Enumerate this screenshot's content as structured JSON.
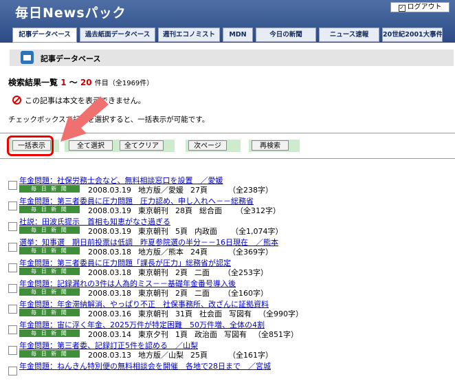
{
  "header": {
    "logo": "毎日Newsパック",
    "logout_label": "ログアウト",
    "tabs": [
      {
        "label": "記事データベース",
        "active": true
      },
      {
        "label": "過去紙面データベース",
        "active": false
      },
      {
        "label": "週刊エコノミスト",
        "active": false
      },
      {
        "label": "MDN",
        "active": false
      },
      {
        "label": "今日の新聞",
        "active": false
      },
      {
        "label": "ニュース速報",
        "active": false
      },
      {
        "label": "20世紀2001大事件",
        "active": false
      }
    ]
  },
  "page_title": "記事データベース",
  "results": {
    "label": "検索結果一覧",
    "from": "1",
    "sep": "～",
    "to": "20",
    "unit": "件目",
    "total": "（全1969件）"
  },
  "notice": "この記事は本文を表示できません。",
  "hint": "チェックボックスで記事を選択すると、一括表示が可能です。",
  "buttons": {
    "bulk_show": "一括表示",
    "select_all": "全て選択",
    "clear_all": "全てクリア",
    "next_page": "次ページ",
    "research": "再検索"
  },
  "source_badge": "毎 日 新 聞",
  "colors": {
    "accent": "#2c4b85",
    "highlight": "#e00000",
    "link": "#0000cc",
    "badge": "#3f8e3a"
  },
  "articles": [
    {
      "headline": "年金問題：社保労務士会など、無料相談窓口を設置　／愛媛",
      "date": "2008.03.19",
      "edition": "地方版／愛媛",
      "page": "27頁",
      "section": "",
      "photo": "",
      "chars": "（全238字）"
    },
    {
      "headline": "年金問題：第三者委員に圧力問題　圧力認め、申し入れへ－－総務省",
      "date": "2008.03.19",
      "edition": "東京朝刊",
      "page": "28頁",
      "section": "総合面",
      "photo": "",
      "chars": "（全312字）"
    },
    {
      "headline": "社説：田波氏提示　首相も知恵がなさ過ぎる",
      "date": "2008.03.19",
      "edition": "東京朝刊",
      "page": "5頁",
      "section": "内政面",
      "photo": "",
      "chars": "（全1,074字）"
    },
    {
      "headline": "選挙：知事選　期日前投票は低調　昨夏参院選の半分－－16日現在　／熊本",
      "date": "2008.03.18",
      "edition": "地方版／熊本",
      "page": "24頁",
      "section": "",
      "photo": "",
      "chars": "（全369字）"
    },
    {
      "headline": "年金問題：第三者委員に圧力問題「課長が圧力」総務省が認定",
      "date": "2008.03.18",
      "edition": "東京朝刊",
      "page": "2頁",
      "section": "二面",
      "photo": "",
      "chars": "（全253字）"
    },
    {
      "headline": "年金問題：記録漏れの3件は人為的ミス－－基礎年金番号導入後",
      "date": "2008.03.18",
      "edition": "東京朝刊",
      "page": "2頁",
      "section": "二面",
      "photo": "",
      "chars": "（全160字）"
    },
    {
      "headline": "年金問題：年金滞納解消、やっぱり不正　社保事務所、改ざんに証拠資料",
      "date": "2008.03.16",
      "edition": "東京朝刊",
      "page": "31頁",
      "section": "社会面",
      "photo": "写図有",
      "chars": "（全990字）"
    },
    {
      "headline": "年金問題：宙に浮く年金、2025万件が特定困難　50万件増、全体の4割",
      "date": "2008.03.14",
      "edition": "東京夕刊",
      "page": "1頁",
      "section": "政治面",
      "photo": "写図有",
      "chars": "（全851字）"
    },
    {
      "headline": "年金問題：第三者委、記録訂正5件を認める　／山梨",
      "date": "2008.03.13",
      "edition": "地方版／山梨",
      "page": "25頁",
      "section": "",
      "photo": "",
      "chars": "（全161字）"
    },
    {
      "headline": "年金問題：ねんきん特別便の無料相談会を開催　各地で28日まで　／宮城",
      "date": "",
      "edition": "",
      "page": "",
      "section": "",
      "photo": "",
      "chars": ""
    }
  ]
}
